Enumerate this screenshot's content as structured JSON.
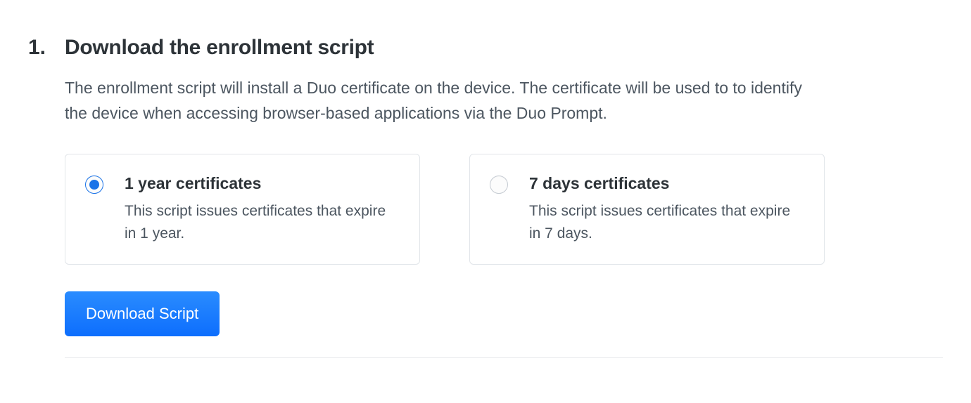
{
  "step": {
    "number": "1.",
    "title": "Download the enrollment script",
    "description": "The enrollment script will install a Duo certificate on the device. The certificate will be used to to identify the device when accessing browser-based applications via the Duo Prompt."
  },
  "options": [
    {
      "title": "1 year certificates",
      "description": "This script issues certificates that expire in 1 year.",
      "selected": true
    },
    {
      "title": "7 days certificates",
      "description": "This script issues certificates that expire in 7 days.",
      "selected": false
    }
  ],
  "button": {
    "download_label": "Download Script"
  }
}
